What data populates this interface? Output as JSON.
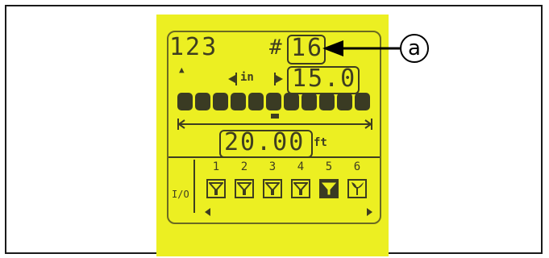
{
  "header": {
    "counter": "123",
    "number_prefix": "#",
    "number_value": "16",
    "up_arrow": "▲"
  },
  "spacing": {
    "unit": "in",
    "value": "15.0"
  },
  "width": {
    "value": "20.00",
    "unit": "ft"
  },
  "rows": {
    "io_label": "I/O",
    "numbers": [
      "1",
      "2",
      "3",
      "4",
      "5",
      "6"
    ],
    "active_row": "5"
  },
  "callout": {
    "label": "a"
  },
  "colors": {
    "lcd": "#ecef22",
    "ink": "#3e3d20"
  }
}
